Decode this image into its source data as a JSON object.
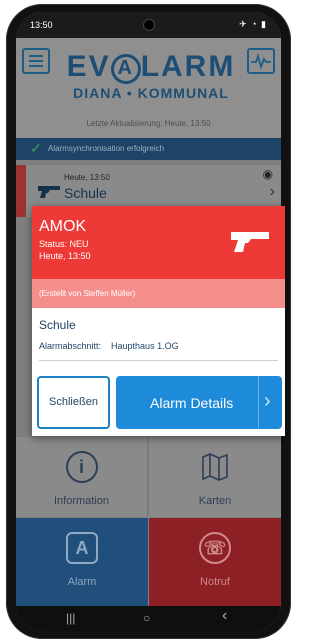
{
  "status_bar": {
    "time": "13:50",
    "right_icons": "✈ ◔ ▮"
  },
  "header": {
    "logo_line1_left": "EV",
    "logo_line1_letter": "A",
    "logo_line1_right": "LARM",
    "logo_line2": "DIANA • KOMMUNAL",
    "last_update": "Letzte Aktualisierung: Heute, 13:50"
  },
  "sync": {
    "text": "Alarmsynchronisation erfolgreich"
  },
  "alarm_row": {
    "date": "Heute, 13:50",
    "name": "Schule"
  },
  "tiles": {
    "info_label": "Information",
    "maps_label": "Karten",
    "alarm_label": "Alarm",
    "notruf_label": "Notruf"
  },
  "dialog": {
    "title": "AMOK",
    "status": "Status: NEU",
    "time": "Heute, 13:50",
    "creator": "(Erstellt von Steffen Müller)",
    "name": "Schule",
    "section_label": "Alarmabschnitt:",
    "section_value": "Haupthaus 1.OG",
    "close_label": "Schließen",
    "details_label": "Alarm Details"
  },
  "colors": {
    "alarm_red": "#ee3a36",
    "primary_blue": "#1d8bd9",
    "brand_navy": "#1e4e74"
  },
  "navbar": {
    "recent": "|||",
    "home": "○",
    "back": "‹"
  }
}
